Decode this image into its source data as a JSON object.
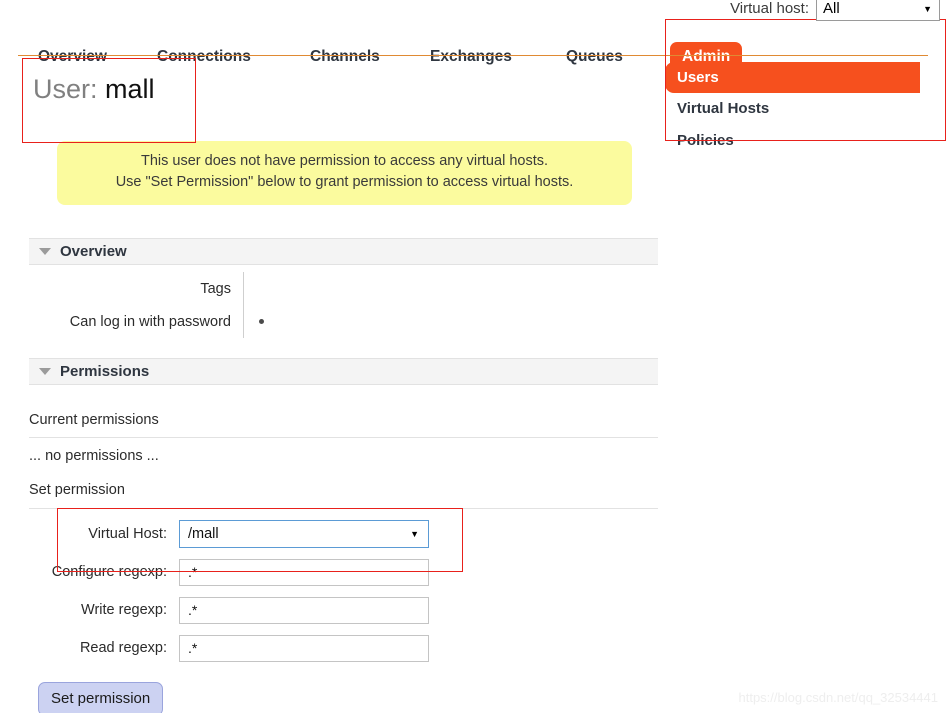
{
  "topbar": {
    "vhost_label": "Virtual host:",
    "vhost_value": "All",
    "caret": "▼"
  },
  "nav": {
    "tabs": [
      {
        "label": "Overview",
        "active": false
      },
      {
        "label": "Connections",
        "active": false
      },
      {
        "label": "Channels",
        "active": false
      },
      {
        "label": "Exchanges",
        "active": false
      },
      {
        "label": "Queues",
        "active": false
      }
    ],
    "admin_tab": "Admin"
  },
  "submenu": {
    "items": [
      {
        "label": "Users",
        "active": true
      },
      {
        "label": "Virtual Hosts",
        "active": false
      },
      {
        "label": "Policies",
        "active": false
      }
    ]
  },
  "page": {
    "title_prefix": "User:",
    "title_name": "mall"
  },
  "warning": {
    "line1": "This user does not have permission to access any virtual hosts.",
    "line2": "Use \"Set Permission\" below to grant permission to access virtual hosts."
  },
  "overview": {
    "heading": "Overview",
    "rows": [
      {
        "key": "Tags",
        "value": ""
      },
      {
        "key": "Can log in with password",
        "value": "•"
      }
    ]
  },
  "permissions": {
    "heading": "Permissions",
    "current_label": "Current permissions",
    "none_label": "... no permissions ...",
    "set_label": "Set permission"
  },
  "form": {
    "vhost_label": "Virtual Host:",
    "vhost_value": "/mall",
    "caret": "▼",
    "configure_label": "Configure regexp:",
    "configure_value": ".*",
    "write_label": "Write regexp:",
    "write_value": ".*",
    "read_label": "Read regexp:",
    "read_value": ".*",
    "submit_label": "Set permission"
  },
  "watermark": "https://blog.csdn.net/qq_32534441",
  "colors": {
    "accent": "#f6501e",
    "warning_bg": "#fbfb9e",
    "annotation": "#e8211b",
    "button_bg": "#ccd2f2"
  }
}
